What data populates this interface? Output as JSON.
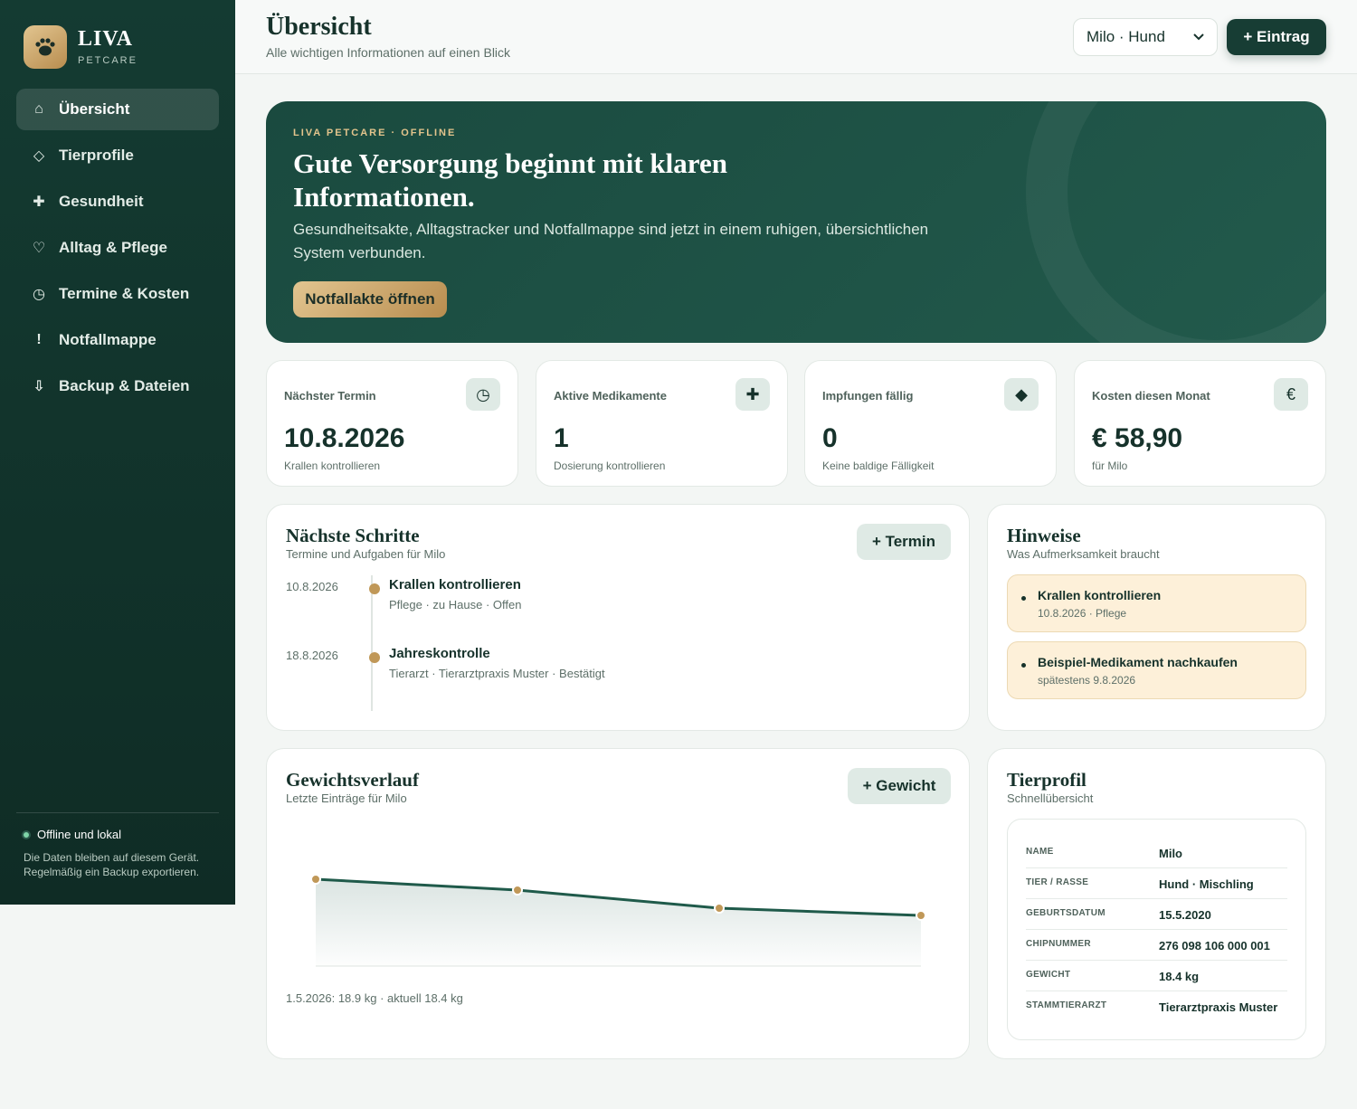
{
  "brand": {
    "name": "LIVA",
    "sub": "PETCARE"
  },
  "nav": [
    {
      "icon": "⌂",
      "label": "Übersicht",
      "active": true
    },
    {
      "icon": "◇",
      "label": "Tierprofile"
    },
    {
      "icon": "✚",
      "label": "Gesundheit"
    },
    {
      "icon": "♡",
      "label": "Alltag & Pflege"
    },
    {
      "icon": "◷",
      "label": "Termine & Kosten"
    },
    {
      "icon": "!",
      "label": "Notfallmappe"
    },
    {
      "icon": "⇩",
      "label": "Backup & Dateien"
    }
  ],
  "sidebar_footer": {
    "status": "Offline und lokal",
    "desc": "Die Daten bleiben auf diesem Gerät. Regelmäßig ein Backup exportieren."
  },
  "header": {
    "title": "Übersicht",
    "subtitle": "Alle wichtigen Informationen auf einen Blick",
    "pet_select": "Milo · Hund",
    "add_button": "+  Eintrag"
  },
  "hero": {
    "kicker": "LIVA PETCARE · OFFLINE",
    "title": "Gute Versorgung beginnt mit klaren Informationen.",
    "text": "Gesundheitsakte, Alltagstracker und Notfallmappe sind jetzt in einem ruhigen, übersichtlichen System verbunden.",
    "button": "Notfallakte öffnen"
  },
  "stats": [
    {
      "label": "Nächster Termin",
      "icon": "◷",
      "value": "10.8.2026",
      "note": "Krallen kontrollieren"
    },
    {
      "label": "Aktive Medikamente",
      "icon": "✚",
      "value": "1",
      "note": "Dosierung kontrollieren"
    },
    {
      "label": "Impfungen fällig",
      "icon": "◆",
      "value": "0",
      "note": "Keine baldige Fälligkeit"
    },
    {
      "label": "Kosten diesen Monat",
      "icon": "€",
      "value": "€ 58,90",
      "note": "für Milo"
    }
  ],
  "steps": {
    "title": "Nächste Schritte",
    "subtitle": "Termine und Aufgaben für Milo",
    "button": "+  Termin",
    "items": [
      {
        "date": "10.8.2026",
        "title": "Krallen kontrollieren",
        "meta": "Pflege · zu Hause · Offen"
      },
      {
        "date": "18.8.2026",
        "title": "Jahreskontrolle",
        "meta": "Tierarzt · Tierarztpraxis Muster · Bestätigt"
      }
    ]
  },
  "hints": {
    "title": "Hinweise",
    "subtitle": "Was Aufmerksamkeit braucht",
    "items": [
      {
        "title": "Krallen kontrollieren",
        "meta": "10.8.2026 · Pflege"
      },
      {
        "title": "Beispiel-Medikament nachkaufen",
        "meta": "spätestens 9.8.2026"
      }
    ]
  },
  "weight": {
    "title": "Gewichtsverlauf",
    "subtitle": "Letzte Einträge für Milo",
    "button": "+  Gewicht",
    "caption": "1.5.2026: 18.9 kg · aktuell 18.4 kg"
  },
  "chart_data": {
    "type": "area",
    "series": [
      {
        "values": [
          18.9,
          18.75,
          18.5,
          18.4
        ]
      }
    ],
    "ylim": [
      17.7,
      19.2
    ],
    "grid": false,
    "colors": {
      "line": "#1f5a4a",
      "point": "#c09858"
    }
  },
  "profile": {
    "title": "Tierprofil",
    "subtitle": "Schnellübersicht",
    "rows": [
      {
        "key": "NAME",
        "value": "Milo"
      },
      {
        "key": "TIER / RASSE",
        "value": "Hund · Mischling"
      },
      {
        "key": "GEBURTSDATUM",
        "value": "15.5.2020"
      },
      {
        "key": "CHIPNUMMER",
        "value": "276 098 106 000 001"
      },
      {
        "key": "GEWICHT",
        "value": "18.4 kg"
      },
      {
        "key": "STAMMTIERARZT",
        "value": "Tierarztpraxis Muster"
      }
    ]
  },
  "colors": {
    "primary": "#173d34",
    "accent": "#c09858",
    "soft": "#dfeae5",
    "hint_bg": "#fdf0d9"
  }
}
